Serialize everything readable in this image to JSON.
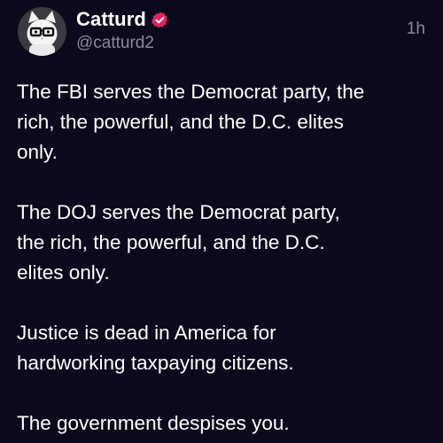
{
  "post": {
    "author": {
      "display_name": "Catturd",
      "handle": "@catturd2",
      "avatar_icon": "cat-with-glasses-avatar",
      "verified_icon": "verified-badge-icon",
      "verified_color": "#e0245e"
    },
    "timestamp": "1h",
    "paragraphs": [
      {
        "lines": [
          "The FBI serves the Democrat party, the",
          "rich, the powerful, and the D.C. elites",
          "only."
        ]
      },
      {
        "lines": [
          "The DOJ serves the Democrat party,",
          "the rich, the powerful, and the D.C.",
          "elites only."
        ]
      },
      {
        "lines": [
          "Justice is dead in America for",
          "hardworking taxpaying citizens."
        ]
      },
      {
        "lines": [
          "The government despises you."
        ]
      }
    ]
  },
  "colors": {
    "background": "#0b0a1c",
    "text": "#ffffff",
    "secondary_text": "#8b8a96"
  }
}
